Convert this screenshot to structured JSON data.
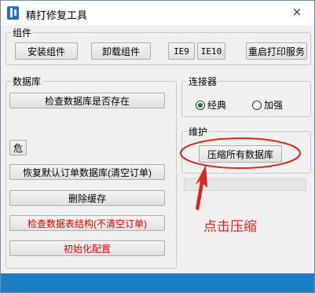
{
  "window": {
    "title": "精打修复工具",
    "close_glyph": "×"
  },
  "components": {
    "legend": "组件",
    "install": "安装组件",
    "uninstall": "卸载组件",
    "ie9": "IE9",
    "ie10": "IE10",
    "restart": "重启打印服务"
  },
  "database": {
    "legend": "数据库",
    "check_exists": "检查数据库是否存在",
    "danger": "危",
    "restore": "恢复默认订单数据库(清空订单)",
    "delete_cache": "删除缓存",
    "check_structure": "检查数据表结构(不清空订单)",
    "initialize": "初始化配置"
  },
  "connector": {
    "legend": "连接器",
    "options": [
      {
        "label": "经典",
        "checked": true
      },
      {
        "label": "加强",
        "checked": false
      }
    ]
  },
  "maintenance": {
    "legend": "维护",
    "compress": "压缩所有数据库",
    "progress": 0
  },
  "annotation": {
    "text": "点击压缩",
    "color": "#e0201c"
  },
  "colors": {
    "statusbar": "#1b7fc6",
    "danger_text": "#d40000",
    "app_icon": "#1e6fc8"
  }
}
